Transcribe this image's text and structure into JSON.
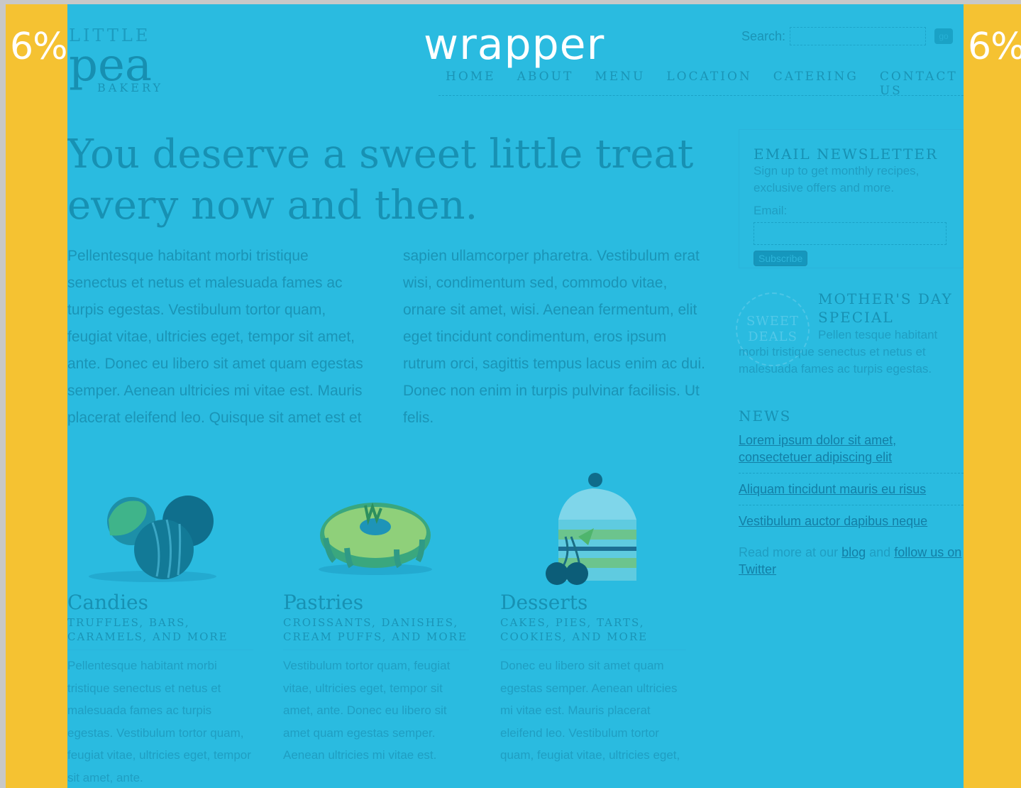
{
  "overlay": {
    "left_label": "6%",
    "right_label": "6%",
    "wrapper_label": "wrapper"
  },
  "logo": {
    "line1": "LITTLE",
    "line2": "pea",
    "line3": "BAKERY"
  },
  "search": {
    "label": "Search:",
    "button": "go"
  },
  "nav": [
    "HOME",
    "ABOUT",
    "MENU",
    "LOCATION",
    "CATERING",
    "CONTACT US"
  ],
  "headline": "You deserve a sweet little treat every now and then.",
  "intro": "Pellentesque habitant morbi tristique senectus et netus et malesuada fames ac turpis egestas. Vestibulum tortor quam, feugiat vitae, ultricies eget, tempor sit amet, ante. Donec eu libero sit amet quam egestas semper. Aenean ultricies mi vitae est. Mauris placerat eleifend leo. Quisque sit amet est et sapien ullamcorper pharetra. Vestibulum erat wisi, condimentum sed, commodo vitae, ornare sit amet, wisi. Aenean fermentum, elit eget tincidunt condimentum, eros ipsum rutrum orci, sagittis tempus lacus enim ac dui. Donec non enim in turpis pulvinar facilisis. Ut felis.",
  "products": [
    {
      "title": "Candies",
      "subtitle": "TRUFFLES, BARS, CARAMELS, AND MORE",
      "text": "Pellentesque habitant morbi tristique senectus et netus et malesuada fames ac turpis egestas. Vestibulum tortor quam, feugiat vitae, ultricies eget, tempor sit amet, ante."
    },
    {
      "title": "Pastries",
      "subtitle": "CROISSANTS, DANISHES, CREAM PUFFS, AND MORE",
      "text": "Vestibulum tortor quam, feugiat vitae, ultricies eget, tempor sit amet, ante. Donec eu libero sit amet quam egestas semper. Aenean ultricies mi vitae est."
    },
    {
      "title": "Desserts",
      "subtitle": "CAKES, PIES, TARTS, COOKIES, AND MORE",
      "text": "Donec eu libero sit amet quam egestas semper. Aenean ultricies mi vitae est. Mauris placerat eleifend leo. Vestibulum tortor quam, feugiat vitae, ultricies eget,"
    }
  ],
  "newsletter": {
    "heading": "EMAIL NEWSLETTER",
    "text": "Sign up to get monthly recipes, exclusive offers and more.",
    "email_label": "Email:",
    "button": "Subscribe"
  },
  "special": {
    "seal_line1": "SWEET",
    "seal_line2": "DEALS",
    "heading": "MOTHER'S DAY SPECIAL",
    "text": "Pellen tesque habitant morbi tristique senectus et netus et malesuada fames ac turpis egestas."
  },
  "news": {
    "heading": "NEWS",
    "links": [
      "Lorem ipsum dolor sit amet, consectetuer adipiscing elit",
      "Aliquam tincidunt mauris eu risus",
      "Vestibulum auctor dapibus neque"
    ],
    "more_prefix": "Read more at our",
    "more_blog": "blog",
    "more_and": "and",
    "more_follow": "follow us on Twitter"
  },
  "colors": {
    "margin": "#f5c232",
    "wrapper_overlay": "#2abbe0"
  }
}
